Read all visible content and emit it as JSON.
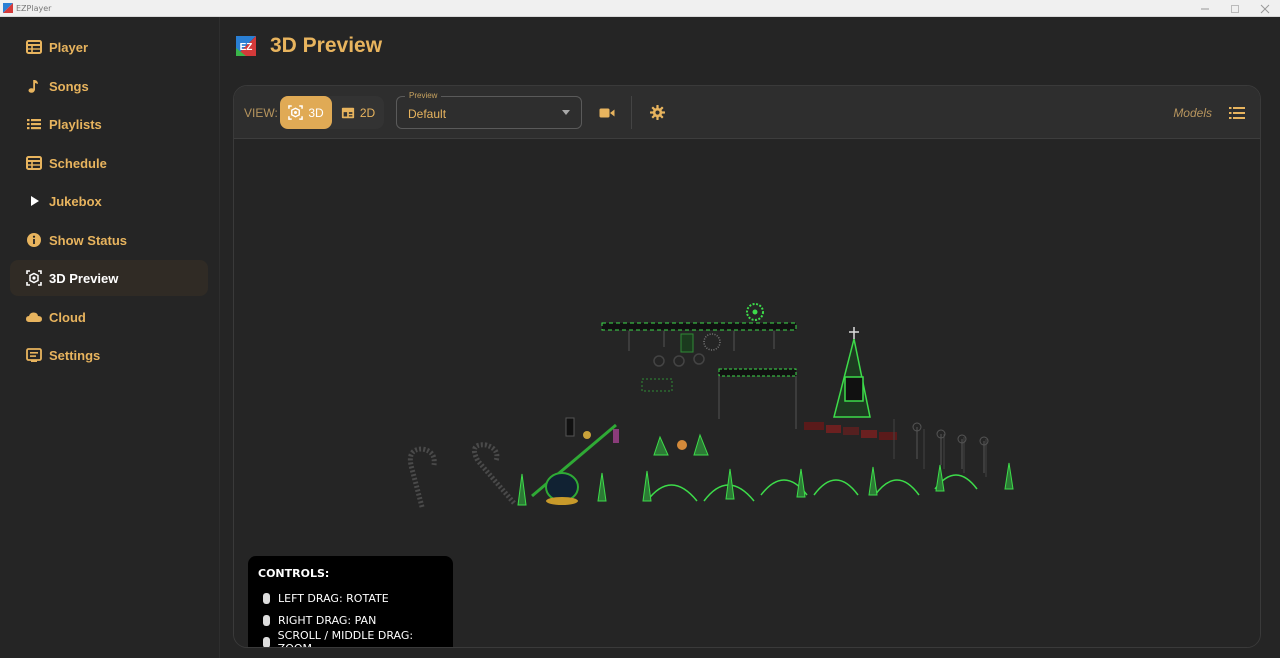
{
  "window": {
    "title": "EZPlayer"
  },
  "sidebar": {
    "items": [
      {
        "label": "Player",
        "icon": "table-icon",
        "active": false
      },
      {
        "label": "Songs",
        "icon": "music-note-icon",
        "active": false
      },
      {
        "label": "Playlists",
        "icon": "list-icon",
        "active": false
      },
      {
        "label": "Schedule",
        "icon": "calendar-grid-icon",
        "active": false
      },
      {
        "label": "Jukebox",
        "icon": "play-icon",
        "active": false
      },
      {
        "label": "Show Status",
        "icon": "info-icon",
        "active": false
      },
      {
        "label": "3D Preview",
        "icon": "cube-view-icon",
        "active": true
      },
      {
        "label": "Cloud",
        "icon": "cloud-icon",
        "active": false
      },
      {
        "label": "Settings",
        "icon": "settings-panel-icon",
        "active": false
      }
    ]
  },
  "page": {
    "title": "3D Preview",
    "logo_text": "EZ"
  },
  "toolbar": {
    "view_label": "VIEW:",
    "view_3d": "3D",
    "view_2d": "2D",
    "view_selected": "3D",
    "preview_legend": "Preview",
    "preview_value": "Default",
    "models_label": "Models"
  },
  "controls": {
    "title": "CONTROLS:",
    "items": [
      "LEFT DRAG: ROTATE",
      "RIGHT DRAG: PAN",
      "SCROLL / MIDDLE DRAG: ZOOM"
    ]
  },
  "colors": {
    "accent": "#e8b45e",
    "accent_button": "#e0aa55",
    "background": "#252525",
    "light_green": "#3ddc4a"
  }
}
